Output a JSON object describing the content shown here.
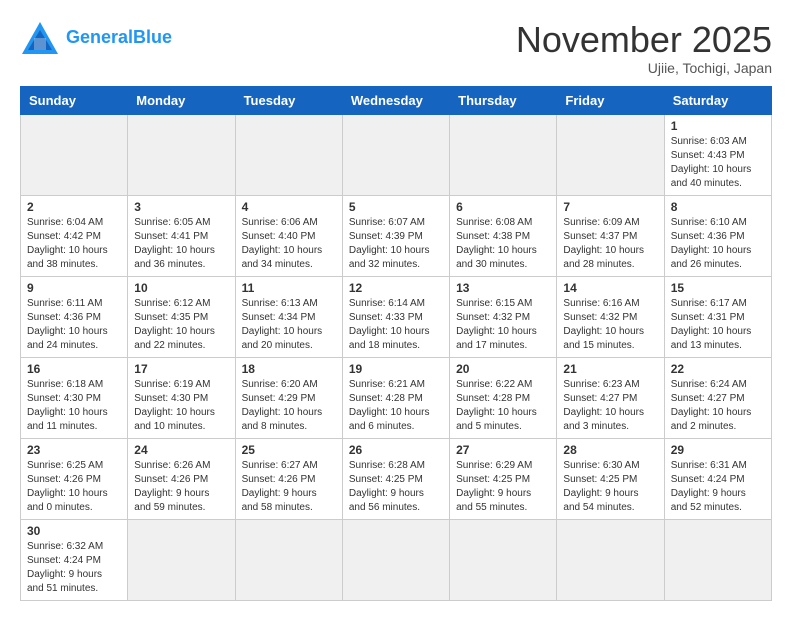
{
  "header": {
    "logo_general": "General",
    "logo_blue": "Blue",
    "month_title": "November 2025",
    "location": "Ujiie, Tochigi, Japan"
  },
  "weekdays": [
    "Sunday",
    "Monday",
    "Tuesday",
    "Wednesday",
    "Thursday",
    "Friday",
    "Saturday"
  ],
  "weeks": [
    [
      {
        "day": "",
        "info": ""
      },
      {
        "day": "",
        "info": ""
      },
      {
        "day": "",
        "info": ""
      },
      {
        "day": "",
        "info": ""
      },
      {
        "day": "",
        "info": ""
      },
      {
        "day": "",
        "info": ""
      },
      {
        "day": "1",
        "info": "Sunrise: 6:03 AM\nSunset: 4:43 PM\nDaylight: 10 hours and 40 minutes."
      }
    ],
    [
      {
        "day": "2",
        "info": "Sunrise: 6:04 AM\nSunset: 4:42 PM\nDaylight: 10 hours and 38 minutes."
      },
      {
        "day": "3",
        "info": "Sunrise: 6:05 AM\nSunset: 4:41 PM\nDaylight: 10 hours and 36 minutes."
      },
      {
        "day": "4",
        "info": "Sunrise: 6:06 AM\nSunset: 4:40 PM\nDaylight: 10 hours and 34 minutes."
      },
      {
        "day": "5",
        "info": "Sunrise: 6:07 AM\nSunset: 4:39 PM\nDaylight: 10 hours and 32 minutes."
      },
      {
        "day": "6",
        "info": "Sunrise: 6:08 AM\nSunset: 4:38 PM\nDaylight: 10 hours and 30 minutes."
      },
      {
        "day": "7",
        "info": "Sunrise: 6:09 AM\nSunset: 4:37 PM\nDaylight: 10 hours and 28 minutes."
      },
      {
        "day": "8",
        "info": "Sunrise: 6:10 AM\nSunset: 4:36 PM\nDaylight: 10 hours and 26 minutes."
      }
    ],
    [
      {
        "day": "9",
        "info": "Sunrise: 6:11 AM\nSunset: 4:36 PM\nDaylight: 10 hours and 24 minutes."
      },
      {
        "day": "10",
        "info": "Sunrise: 6:12 AM\nSunset: 4:35 PM\nDaylight: 10 hours and 22 minutes."
      },
      {
        "day": "11",
        "info": "Sunrise: 6:13 AM\nSunset: 4:34 PM\nDaylight: 10 hours and 20 minutes."
      },
      {
        "day": "12",
        "info": "Sunrise: 6:14 AM\nSunset: 4:33 PM\nDaylight: 10 hours and 18 minutes."
      },
      {
        "day": "13",
        "info": "Sunrise: 6:15 AM\nSunset: 4:32 PM\nDaylight: 10 hours and 17 minutes."
      },
      {
        "day": "14",
        "info": "Sunrise: 6:16 AM\nSunset: 4:32 PM\nDaylight: 10 hours and 15 minutes."
      },
      {
        "day": "15",
        "info": "Sunrise: 6:17 AM\nSunset: 4:31 PM\nDaylight: 10 hours and 13 minutes."
      }
    ],
    [
      {
        "day": "16",
        "info": "Sunrise: 6:18 AM\nSunset: 4:30 PM\nDaylight: 10 hours and 11 minutes."
      },
      {
        "day": "17",
        "info": "Sunrise: 6:19 AM\nSunset: 4:30 PM\nDaylight: 10 hours and 10 minutes."
      },
      {
        "day": "18",
        "info": "Sunrise: 6:20 AM\nSunset: 4:29 PM\nDaylight: 10 hours and 8 minutes."
      },
      {
        "day": "19",
        "info": "Sunrise: 6:21 AM\nSunset: 4:28 PM\nDaylight: 10 hours and 6 minutes."
      },
      {
        "day": "20",
        "info": "Sunrise: 6:22 AM\nSunset: 4:28 PM\nDaylight: 10 hours and 5 minutes."
      },
      {
        "day": "21",
        "info": "Sunrise: 6:23 AM\nSunset: 4:27 PM\nDaylight: 10 hours and 3 minutes."
      },
      {
        "day": "22",
        "info": "Sunrise: 6:24 AM\nSunset: 4:27 PM\nDaylight: 10 hours and 2 minutes."
      }
    ],
    [
      {
        "day": "23",
        "info": "Sunrise: 6:25 AM\nSunset: 4:26 PM\nDaylight: 10 hours and 0 minutes."
      },
      {
        "day": "24",
        "info": "Sunrise: 6:26 AM\nSunset: 4:26 PM\nDaylight: 9 hours and 59 minutes."
      },
      {
        "day": "25",
        "info": "Sunrise: 6:27 AM\nSunset: 4:26 PM\nDaylight: 9 hours and 58 minutes."
      },
      {
        "day": "26",
        "info": "Sunrise: 6:28 AM\nSunset: 4:25 PM\nDaylight: 9 hours and 56 minutes."
      },
      {
        "day": "27",
        "info": "Sunrise: 6:29 AM\nSunset: 4:25 PM\nDaylight: 9 hours and 55 minutes."
      },
      {
        "day": "28",
        "info": "Sunrise: 6:30 AM\nSunset: 4:25 PM\nDaylight: 9 hours and 54 minutes."
      },
      {
        "day": "29",
        "info": "Sunrise: 6:31 AM\nSunset: 4:24 PM\nDaylight: 9 hours and 52 minutes."
      }
    ],
    [
      {
        "day": "30",
        "info": "Sunrise: 6:32 AM\nSunset: 4:24 PM\nDaylight: 9 hours and 51 minutes."
      },
      {
        "day": "",
        "info": ""
      },
      {
        "day": "",
        "info": ""
      },
      {
        "day": "",
        "info": ""
      },
      {
        "day": "",
        "info": ""
      },
      {
        "day": "",
        "info": ""
      },
      {
        "day": "",
        "info": ""
      }
    ]
  ]
}
